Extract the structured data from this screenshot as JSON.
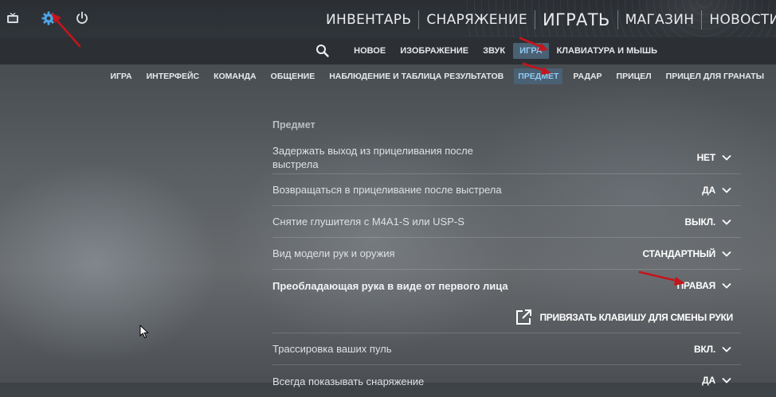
{
  "top_icons": [
    "tv-icon",
    "gear-icon",
    "power-icon"
  ],
  "main_nav": [
    "ИНВЕНТАРЬ",
    "СНАРЯЖЕНИЕ",
    "ИГРАТЬ",
    "МАГАЗИН",
    "НОВОСТИ"
  ],
  "sub_nav": [
    "НОВОЕ",
    "ИЗОБРАЖЕНИЕ",
    "ЗВУК",
    "ИГРА",
    "КЛАВИАТУРА И МЫШЬ"
  ],
  "sub_nav2": [
    "ИГРА",
    "ИНТЕРФЕЙС",
    "КОМАНДА",
    "ОБЩЕНИЕ",
    "НАБЛЮДЕНИЕ И ТАБЛИЦА РЕЗУЛЬТАТОВ",
    "ПРЕДМЕТ",
    "РАДАР",
    "ПРИЦЕЛ",
    "ПРИЦЕЛ ДЛЯ ГРАНАТЫ"
  ],
  "settings": {
    "section_title": "Предмет",
    "rows": [
      {
        "label": "Задержать выход из прицеливания после выстрела",
        "value": "НЕТ"
      },
      {
        "label": "Возвращаться в прицеливание после выстрела",
        "value": "ДА"
      },
      {
        "label": "Снятие глушителя с M4A1-S или USP-S",
        "value": "ВЫКЛ."
      },
      {
        "label": "Вид модели рук и оружия",
        "value": "СТАНДАРТНЫЙ"
      },
      {
        "label": "Преобладающая рука в виде от первого лица",
        "value": "ПРАВАЯ"
      },
      {
        "label": "Трассировка ваших пуль",
        "value": "ВКЛ."
      },
      {
        "label": "Всегда показывать снаряжение",
        "value": "ДА"
      }
    ],
    "bind_hand_label": "ПРИВЯЗАТЬ КЛАВИШУ ДЛЯ СМЕНЫ РУКИ"
  },
  "colors": {
    "accent": "#4a6073",
    "accent_text": "#8fc9ef",
    "annotation_arrow": "#c4151c",
    "gear": "#4ea4e6"
  }
}
